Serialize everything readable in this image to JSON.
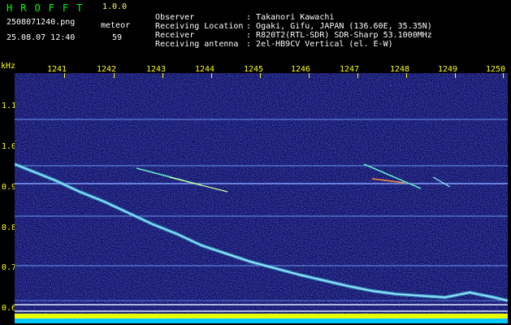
{
  "header": {
    "app_title": "HROFFT",
    "version": "1.0.0",
    "file_name": "2508071240.png",
    "meteor_label": "meteor",
    "timestamp": "25.08.07 12:40",
    "meteor_count": "59"
  },
  "info": [
    {
      "key": "Observer",
      "value": "Takanori Kawachi"
    },
    {
      "key": "Receiving Location",
      "value": "Ogaki, Gifu, JAPAN (136.60E, 35.35N)"
    },
    {
      "key": "Receiver",
      "value": "R820T2(RTL-SDR) SDR-Sharp 53.1000MHz"
    },
    {
      "key": "Receiving antenna",
      "value": "2el-HB9CV Vertical (el. E-W)"
    }
  ],
  "spectrogram": {
    "y_unit": "kHz",
    "y_ticks": [
      "1.1",
      "1.0",
      "0.9",
      "0.8",
      "0.7",
      "0.6"
    ],
    "x_ticks": [
      "1241",
      "1242",
      "1243",
      "1244",
      "1245",
      "1246",
      "1247",
      "1248",
      "1249",
      "1250"
    ],
    "background_color": "#0b0a5a",
    "tick_color": "#ffff00"
  }
}
